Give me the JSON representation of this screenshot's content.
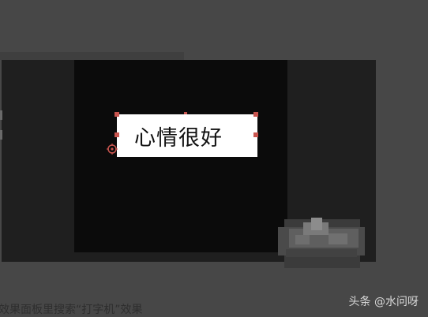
{
  "preview": {
    "title_text": "心情很好"
  },
  "caption": {
    "text": "效果面板里搜索“打字机”效果"
  },
  "watermark": {
    "text": "头条 @水问呀"
  },
  "colors": {
    "background": "#474747",
    "panel": "#1f1f1f",
    "canvas": "#0b0b0b",
    "title_box": "#ffffff",
    "selection_handle": "#c8554f"
  },
  "icons": {
    "anchor": "anchor-point-icon",
    "mosaic": "blurred-mosaic-logo"
  }
}
